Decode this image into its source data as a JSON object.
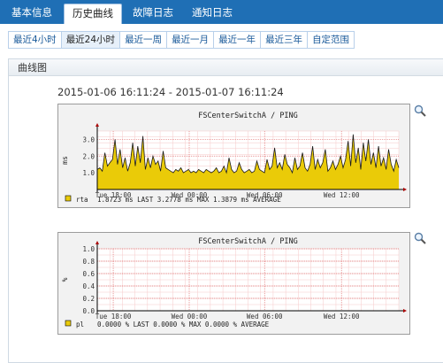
{
  "tabs": [
    {
      "label": "基本信息",
      "active": false
    },
    {
      "label": "历史曲线",
      "active": true
    },
    {
      "label": "故障日志",
      "active": false
    },
    {
      "label": "通知日志",
      "active": false
    }
  ],
  "ranges": [
    {
      "label": "最近4小时",
      "active": false
    },
    {
      "label": "最近24小时",
      "active": true
    },
    {
      "label": "最近一周",
      "active": false
    },
    {
      "label": "最近一月",
      "active": false
    },
    {
      "label": "最近一年",
      "active": false
    },
    {
      "label": "最近三年",
      "active": false
    },
    {
      "label": "自定范围",
      "active": false
    }
  ],
  "panel": {
    "title": "曲线图"
  },
  "time_range": "2015-01-06 16:11:24 - 2015-01-07 16:11:24",
  "colors": {
    "tab_bar": "#1f6fb5",
    "area": "#eacb08",
    "line": "#1a1a1a",
    "grid": "#f08080"
  },
  "chart_data": [
    {
      "type": "area",
      "title": "FSCenterSwitchA / PING",
      "ylabel": "ms",
      "ylim": [
        0,
        3.5
      ],
      "yticks": [
        "1.0",
        "2.0",
        "3.0"
      ],
      "xticks": [
        "Tue 18:00",
        "Wed 00:00",
        "Wed 06:00",
        "Wed 12:00"
      ],
      "series": [
        {
          "name": "rta",
          "values": [
            1.2,
            1.3,
            1.1,
            2.2,
            1.4,
            1.6,
            1.8,
            3.0,
            1.5,
            2.4,
            1.3,
            1.9,
            1.1,
            1.6,
            2.8,
            1.4,
            2.6,
            1.6,
            3.2,
            1.2,
            1.9,
            1.3,
            2.0,
            1.5,
            1.7,
            1.1,
            2.3,
            1.3,
            1.2,
            1.1,
            1.0,
            1.2,
            1.1,
            1.3,
            1.0,
            1.1,
            1.2,
            1.0,
            1.1,
            1.0,
            1.2,
            1.1,
            1.0,
            1.2,
            1.1,
            1.0,
            1.1,
            1.3,
            1.0,
            1.1,
            1.4,
            1.0,
            1.9,
            1.2,
            1.0,
            1.1,
            1.6,
            1.2,
            1.0,
            1.1,
            1.2,
            1.0,
            1.1,
            1.7,
            1.2,
            1.1,
            1.0,
            1.8,
            1.2,
            1.4,
            2.5,
            1.3,
            1.6,
            1.2,
            2.1,
            1.5,
            1.3,
            1.0,
            1.9,
            1.2,
            1.4,
            2.2,
            1.3,
            1.1,
            1.5,
            2.6,
            1.2,
            1.8,
            1.3,
            1.6,
            2.4,
            1.1,
            1.3,
            1.7,
            1.2,
            1.5,
            2.0,
            1.3,
            1.8,
            2.9,
            1.4,
            3.3,
            1.6,
            2.5,
            1.2,
            2.8,
            1.7,
            3.0,
            1.5,
            2.2,
            1.3,
            2.6,
            1.4,
            1.9,
            1.2,
            2.4,
            1.5,
            1.1,
            1.8,
            1.3
          ]
        }
      ],
      "legend": [
        {
          "name": "rta",
          "text": "1.8723 ms LAST     3.2778 ms MAX     1.3879 ms AVERAGE"
        }
      ]
    },
    {
      "type": "area",
      "title": "FSCenterSwitchA / PING",
      "ylabel": "%",
      "ylim": [
        0,
        1.0
      ],
      "yticks": [
        "0.0",
        "0.2",
        "0.4",
        "0.6",
        "0.8",
        "1.0"
      ],
      "xticks": [
        "Tue 18:00",
        "Wed 00:00",
        "Wed 06:00",
        "Wed 12:00"
      ],
      "series": [
        {
          "name": "pl",
          "values": [
            0,
            0,
            0,
            0,
            0
          ]
        }
      ],
      "legend": [
        {
          "name": "pl",
          "text": "0.0000 % LAST      0.0000 % MAX      0.0000 % AVERAGE"
        }
      ]
    }
  ]
}
